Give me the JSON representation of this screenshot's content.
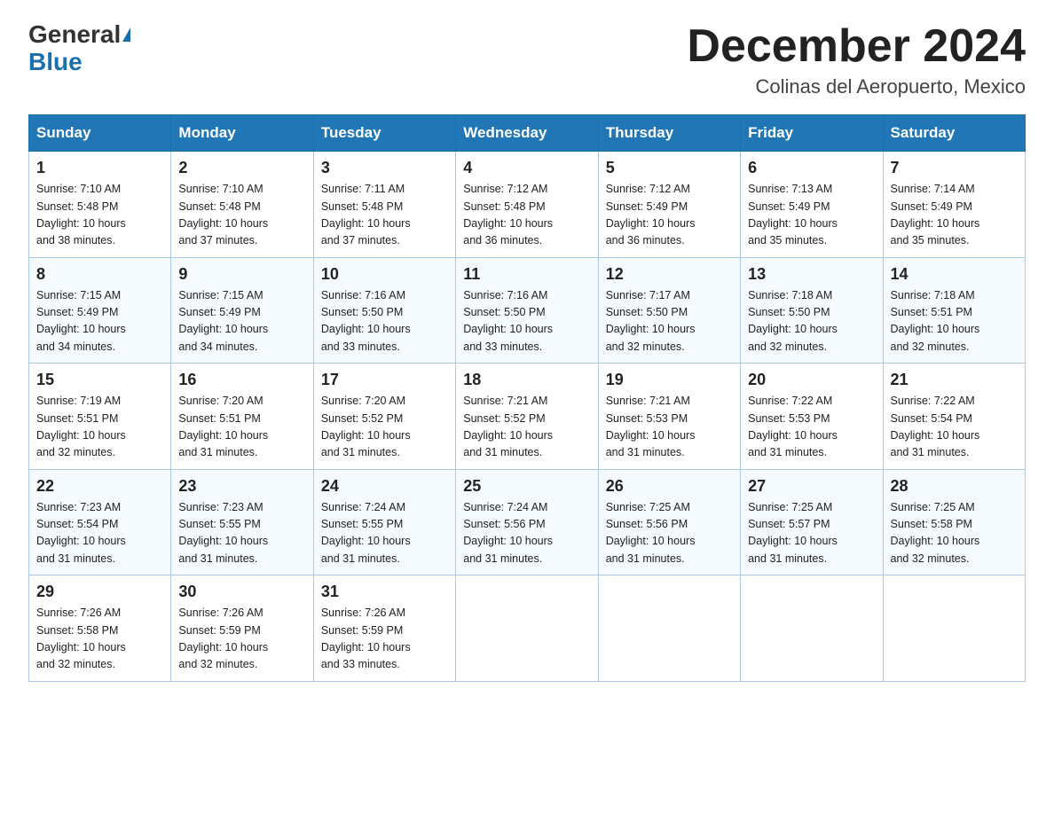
{
  "logo": {
    "general": "General",
    "blue": "Blue",
    "triangle": true
  },
  "title": "December 2024",
  "subtitle": "Colinas del Aeropuerto, Mexico",
  "days_of_week": [
    "Sunday",
    "Monday",
    "Tuesday",
    "Wednesday",
    "Thursday",
    "Friday",
    "Saturday"
  ],
  "weeks": [
    [
      {
        "day": 1,
        "sunrise": "7:10 AM",
        "sunset": "5:48 PM",
        "daylight": "10 hours and 38 minutes."
      },
      {
        "day": 2,
        "sunrise": "7:10 AM",
        "sunset": "5:48 PM",
        "daylight": "10 hours and 37 minutes."
      },
      {
        "day": 3,
        "sunrise": "7:11 AM",
        "sunset": "5:48 PM",
        "daylight": "10 hours and 37 minutes."
      },
      {
        "day": 4,
        "sunrise": "7:12 AM",
        "sunset": "5:48 PM",
        "daylight": "10 hours and 36 minutes."
      },
      {
        "day": 5,
        "sunrise": "7:12 AM",
        "sunset": "5:49 PM",
        "daylight": "10 hours and 36 minutes."
      },
      {
        "day": 6,
        "sunrise": "7:13 AM",
        "sunset": "5:49 PM",
        "daylight": "10 hours and 35 minutes."
      },
      {
        "day": 7,
        "sunrise": "7:14 AM",
        "sunset": "5:49 PM",
        "daylight": "10 hours and 35 minutes."
      }
    ],
    [
      {
        "day": 8,
        "sunrise": "7:15 AM",
        "sunset": "5:49 PM",
        "daylight": "10 hours and 34 minutes."
      },
      {
        "day": 9,
        "sunrise": "7:15 AM",
        "sunset": "5:49 PM",
        "daylight": "10 hours and 34 minutes."
      },
      {
        "day": 10,
        "sunrise": "7:16 AM",
        "sunset": "5:50 PM",
        "daylight": "10 hours and 33 minutes."
      },
      {
        "day": 11,
        "sunrise": "7:16 AM",
        "sunset": "5:50 PM",
        "daylight": "10 hours and 33 minutes."
      },
      {
        "day": 12,
        "sunrise": "7:17 AM",
        "sunset": "5:50 PM",
        "daylight": "10 hours and 32 minutes."
      },
      {
        "day": 13,
        "sunrise": "7:18 AM",
        "sunset": "5:50 PM",
        "daylight": "10 hours and 32 minutes."
      },
      {
        "day": 14,
        "sunrise": "7:18 AM",
        "sunset": "5:51 PM",
        "daylight": "10 hours and 32 minutes."
      }
    ],
    [
      {
        "day": 15,
        "sunrise": "7:19 AM",
        "sunset": "5:51 PM",
        "daylight": "10 hours and 32 minutes."
      },
      {
        "day": 16,
        "sunrise": "7:20 AM",
        "sunset": "5:51 PM",
        "daylight": "10 hours and 31 minutes."
      },
      {
        "day": 17,
        "sunrise": "7:20 AM",
        "sunset": "5:52 PM",
        "daylight": "10 hours and 31 minutes."
      },
      {
        "day": 18,
        "sunrise": "7:21 AM",
        "sunset": "5:52 PM",
        "daylight": "10 hours and 31 minutes."
      },
      {
        "day": 19,
        "sunrise": "7:21 AM",
        "sunset": "5:53 PM",
        "daylight": "10 hours and 31 minutes."
      },
      {
        "day": 20,
        "sunrise": "7:22 AM",
        "sunset": "5:53 PM",
        "daylight": "10 hours and 31 minutes."
      },
      {
        "day": 21,
        "sunrise": "7:22 AM",
        "sunset": "5:54 PM",
        "daylight": "10 hours and 31 minutes."
      }
    ],
    [
      {
        "day": 22,
        "sunrise": "7:23 AM",
        "sunset": "5:54 PM",
        "daylight": "10 hours and 31 minutes."
      },
      {
        "day": 23,
        "sunrise": "7:23 AM",
        "sunset": "5:55 PM",
        "daylight": "10 hours and 31 minutes."
      },
      {
        "day": 24,
        "sunrise": "7:24 AM",
        "sunset": "5:55 PM",
        "daylight": "10 hours and 31 minutes."
      },
      {
        "day": 25,
        "sunrise": "7:24 AM",
        "sunset": "5:56 PM",
        "daylight": "10 hours and 31 minutes."
      },
      {
        "day": 26,
        "sunrise": "7:25 AM",
        "sunset": "5:56 PM",
        "daylight": "10 hours and 31 minutes."
      },
      {
        "day": 27,
        "sunrise": "7:25 AM",
        "sunset": "5:57 PM",
        "daylight": "10 hours and 31 minutes."
      },
      {
        "day": 28,
        "sunrise": "7:25 AM",
        "sunset": "5:58 PM",
        "daylight": "10 hours and 32 minutes."
      }
    ],
    [
      {
        "day": 29,
        "sunrise": "7:26 AM",
        "sunset": "5:58 PM",
        "daylight": "10 hours and 32 minutes."
      },
      {
        "day": 30,
        "sunrise": "7:26 AM",
        "sunset": "5:59 PM",
        "daylight": "10 hours and 32 minutes."
      },
      {
        "day": 31,
        "sunrise": "7:26 AM",
        "sunset": "5:59 PM",
        "daylight": "10 hours and 33 minutes."
      },
      null,
      null,
      null,
      null
    ]
  ],
  "labels": {
    "sunrise_prefix": "Sunrise: ",
    "sunset_prefix": "Sunset: ",
    "daylight_prefix": "Daylight: "
  }
}
